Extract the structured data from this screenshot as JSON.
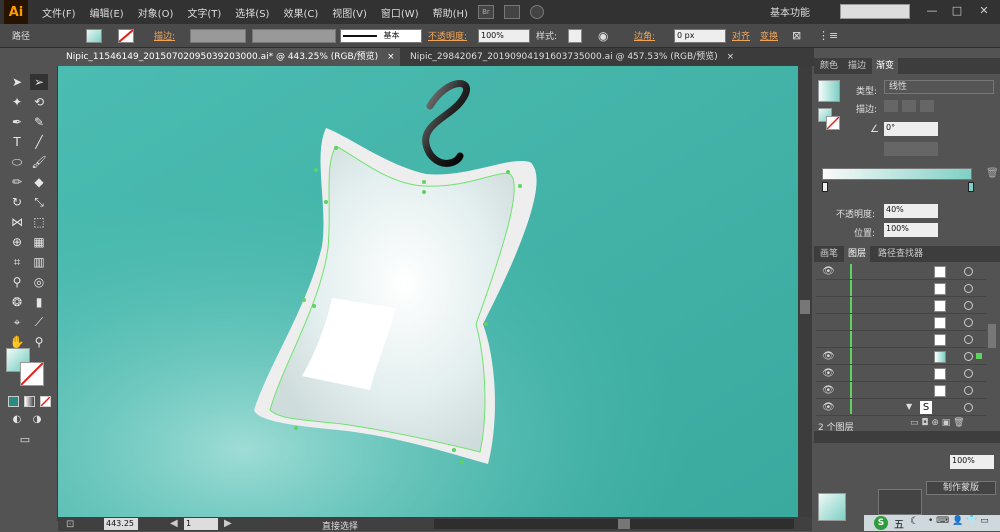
{
  "app": {
    "logo": "Ai"
  },
  "menubar": {
    "items": [
      "文件(F)",
      "编辑(E)",
      "对象(O)",
      "文字(T)",
      "选择(S)",
      "效果(C)",
      "视图(V)",
      "窗口(W)",
      "帮助(H)"
    ],
    "br_label": "Br",
    "workspace": "基本功能",
    "minimize": "—",
    "maximize": "□",
    "close": "✕"
  },
  "controlbar": {
    "object_type": "路径",
    "stroke_label": "描边:",
    "stroke_style": "基本",
    "opacity_label": "不透明度:",
    "opacity_value": "100%",
    "style_label": "样式:",
    "corner_label": "边角:",
    "corner_value": "0 px",
    "align_label": "对齐",
    "transform_label": "变换"
  },
  "tabs": [
    {
      "label": "Nipic_11546149_20150702095039203000.ai* @ 443.25% (RGB/预览)",
      "close": "×"
    },
    {
      "label": "Nipic_29842067_20190904191603735000.ai @ 457.53% (RGB/预览)",
      "close": "×"
    }
  ],
  "gradient_panel": {
    "tabs": [
      "颜色",
      "描边",
      "渐变"
    ],
    "type_label": "类型:",
    "type_value": "线性",
    "stroke_label": "描边:",
    "angle_value": "0°",
    "opacity_label": "不透明度:",
    "opacity_value": "40%",
    "position_label": "位置:",
    "position_value": "100%"
  },
  "layers_panel": {
    "tabs": [
      "画笔",
      "图层",
      "路径查找器"
    ],
    "footer": "2 个图层",
    "symbol_glyph": "S"
  },
  "bottom_panel": {
    "opacity_value": "100%",
    "mask_button": "制作蒙版"
  },
  "statusbar": {
    "zoom": "443.25",
    "page": "1",
    "tool_name": "直接选择"
  },
  "taskbar": {
    "ime_label": "五",
    "moon_glyph": "☾"
  },
  "colors": {
    "canvas_bg": "#4fbcb0",
    "accent": "#f2a55a",
    "path_highlight": "#5fd35f"
  }
}
